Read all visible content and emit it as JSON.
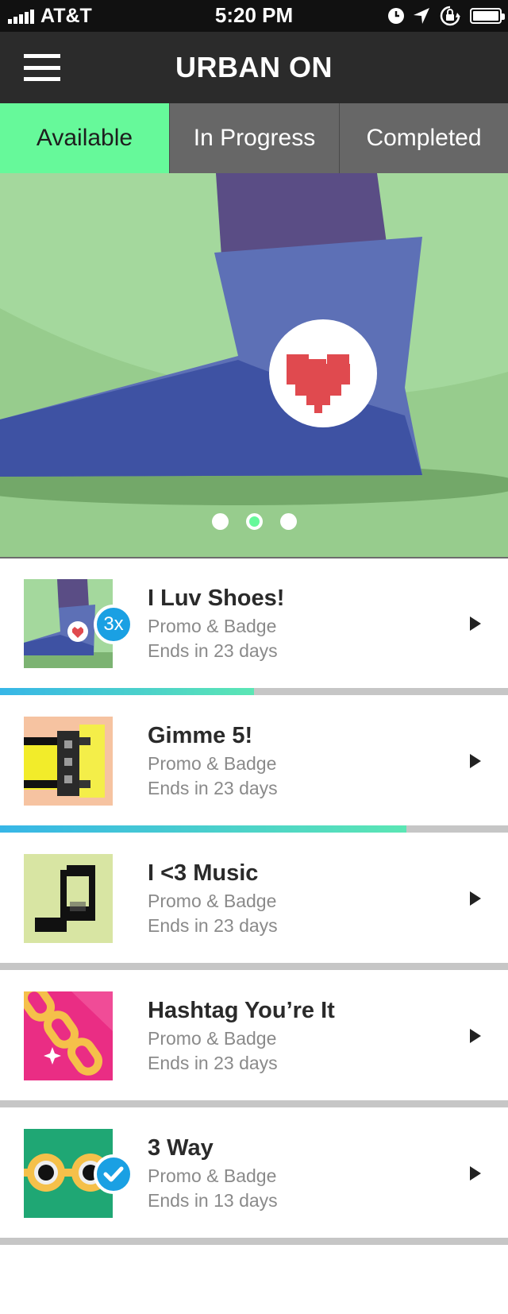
{
  "status_bar": {
    "carrier": "AT&T",
    "time": "5:20 PM"
  },
  "header": {
    "title": "URBAN ON",
    "menu_icon": "hamburger-menu-icon"
  },
  "tabs": [
    {
      "label": "Available",
      "active": true
    },
    {
      "label": "In Progress",
      "active": false
    },
    {
      "label": "Completed",
      "active": false
    }
  ],
  "carousel": {
    "slide_count": 3,
    "active_index": 1,
    "icon": "heart-icon"
  },
  "promos": [
    {
      "title": "I Luv Shoes!",
      "subtitle": "Promo & Badge",
      "ends": "Ends in 23 days",
      "badge": "3x",
      "progress": 0.5
    },
    {
      "title": "Gimme 5!",
      "subtitle": "Promo & Badge",
      "ends": "Ends in 23 days",
      "progress": 0.8
    },
    {
      "title": "I <3 Music",
      "subtitle": "Promo & Badge",
      "ends": "Ends in 23 days",
      "progress": 0
    },
    {
      "title": "Hashtag You’re It",
      "subtitle": "Promo & Badge",
      "ends": "Ends in 23 days",
      "progress": 0
    },
    {
      "title": "3 Way",
      "subtitle": "Promo & Badge",
      "ends": "Ends in 13 days",
      "completed": true,
      "progress": 0
    }
  ],
  "colors": {
    "accent_green": "#66f99a",
    "header_dark": "#2b2b2b",
    "tab_gray": "#676767",
    "badge_blue": "#1aa0e3"
  }
}
